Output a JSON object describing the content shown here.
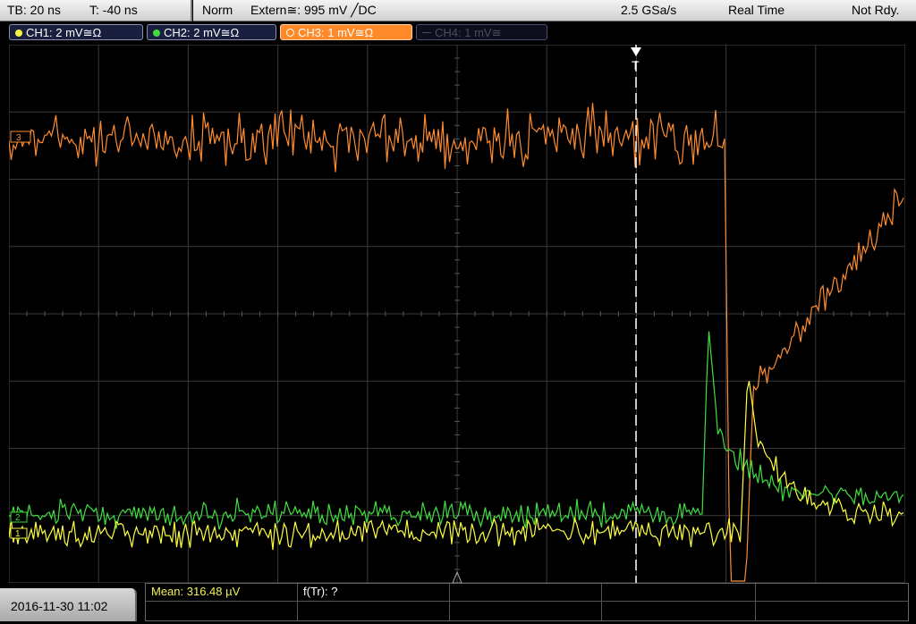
{
  "top": {
    "timebase": "TB: 20 ns",
    "trigger_time": "T: -40 ns",
    "trigger_mode": "Norm",
    "trigger_source": "Extern≅: 995 mV ╱DC",
    "sample_rate": "2.5 GSa/s",
    "acq_mode": "Real Time",
    "status": "Not Rdy."
  },
  "channels": [
    {
      "label": "CH1: 2 mV≅Ω",
      "color": "#f5f542",
      "state": "on"
    },
    {
      "label": "CH2: 2 mV≅Ω",
      "color": "#3cdc3c",
      "state": "on"
    },
    {
      "label": "CH3: 1 mV≅Ω",
      "color": "#ff8a2a",
      "state": "selected"
    },
    {
      "label": "CH4: 1 mV≅",
      "color": "#555870",
      "state": "off"
    }
  ],
  "markers": {
    "trigger": "T",
    "ch3": "3",
    "ch1": "1",
    "ch2": "2"
  },
  "bottom": {
    "datetime": "2016-11-30 11:02",
    "mean": "Mean: 316.48 µV",
    "ftr": "f(Tr): ?"
  },
  "colors": {
    "ch1": "#ffff40",
    "ch2": "#40e040",
    "ch3": "#ff8c30",
    "grid": "#3a3a3a"
  }
}
